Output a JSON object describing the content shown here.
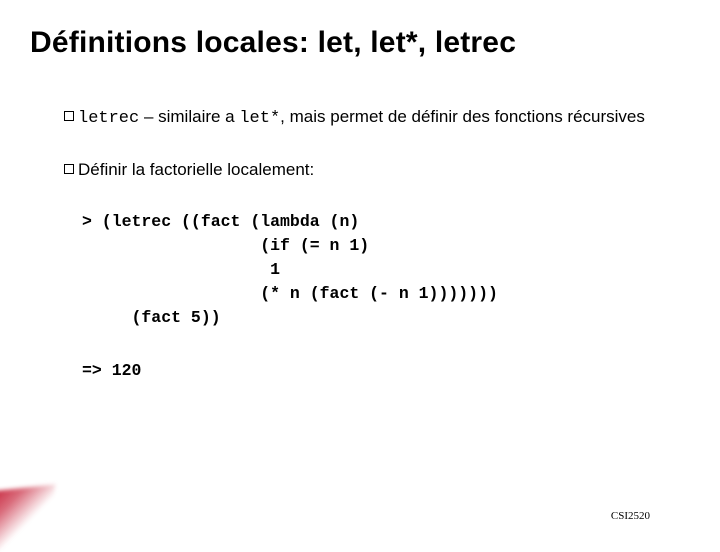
{
  "title": "Définitions locales: let, let*, letrec",
  "bullets": {
    "b1_code": "letrec",
    "b1_text_a": " – similaire a ",
    "b1_code2": "let*",
    "b1_text_b": ", mais permet de définir des fonctions récursives",
    "b2_text": "Définir la factorielle localement:"
  },
  "code": {
    "line1": "> (letrec ((fact (lambda (n)",
    "line2": "                  (if (= n 1)",
    "line3": "                   1",
    "line4": "                  (* n (fact (- n 1)))))))",
    "line5": "     (fact 5))",
    "result": "=> 120"
  },
  "footer": "CSI2520"
}
